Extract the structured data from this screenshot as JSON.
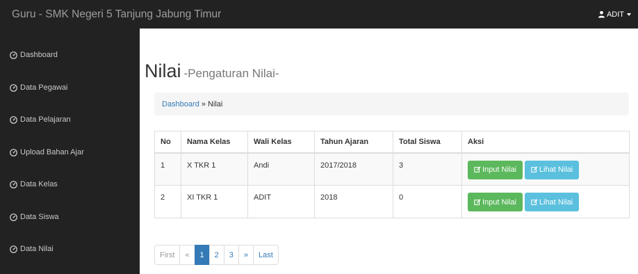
{
  "navbar": {
    "brand": "Guru - SMK Negeri 5 Tanjung Jabung Timur",
    "user": "ADIT"
  },
  "sidebar": {
    "items": [
      {
        "label": "Dashboard",
        "icon": "dashboard-icon"
      },
      {
        "label": "Data Pegawai",
        "icon": "dashboard-icon"
      },
      {
        "label": "Data Pelajaran",
        "icon": "dashboard-icon"
      },
      {
        "label": "Upload Bahan Ajar",
        "icon": "dashboard-icon"
      },
      {
        "label": "Data Kelas",
        "icon": "dashboard-icon"
      },
      {
        "label": "Data Siswa",
        "icon": "dashboard-icon"
      },
      {
        "label": "Data Nilai",
        "icon": "dashboard-icon"
      }
    ]
  },
  "page": {
    "title": "Nilai",
    "subtitle": "-Pengaturan Nilai-"
  },
  "breadcrumb": {
    "link": "Dashboard",
    "separator": "»",
    "current": "Nilai"
  },
  "table": {
    "headers": [
      "No",
      "Nama Kelas",
      "Wali Kelas",
      "Tahun Ajaran",
      "Total Siswa",
      "Aksi"
    ],
    "rows": [
      {
        "no": "1",
        "nama_kelas": "X TKR 1",
        "wali_kelas": "Andi",
        "tahun_ajaran": "2017/2018",
        "total_siswa": "3"
      },
      {
        "no": "2",
        "nama_kelas": "XI TKR 1",
        "wali_kelas": "ADIT",
        "tahun_ajaran": "2018",
        "total_siswa": "0"
      }
    ],
    "input_label": "Input Nilai",
    "lihat_label": "Lihat Nilai"
  },
  "pagination": {
    "first": "First",
    "prev": "«",
    "pages": [
      "1",
      "2",
      "3"
    ],
    "next": "»",
    "last": "Last"
  },
  "colors": {
    "navbar_bg": "#222222",
    "success": "#5cb85c",
    "info": "#5bc0de",
    "link": "#337ab7"
  }
}
